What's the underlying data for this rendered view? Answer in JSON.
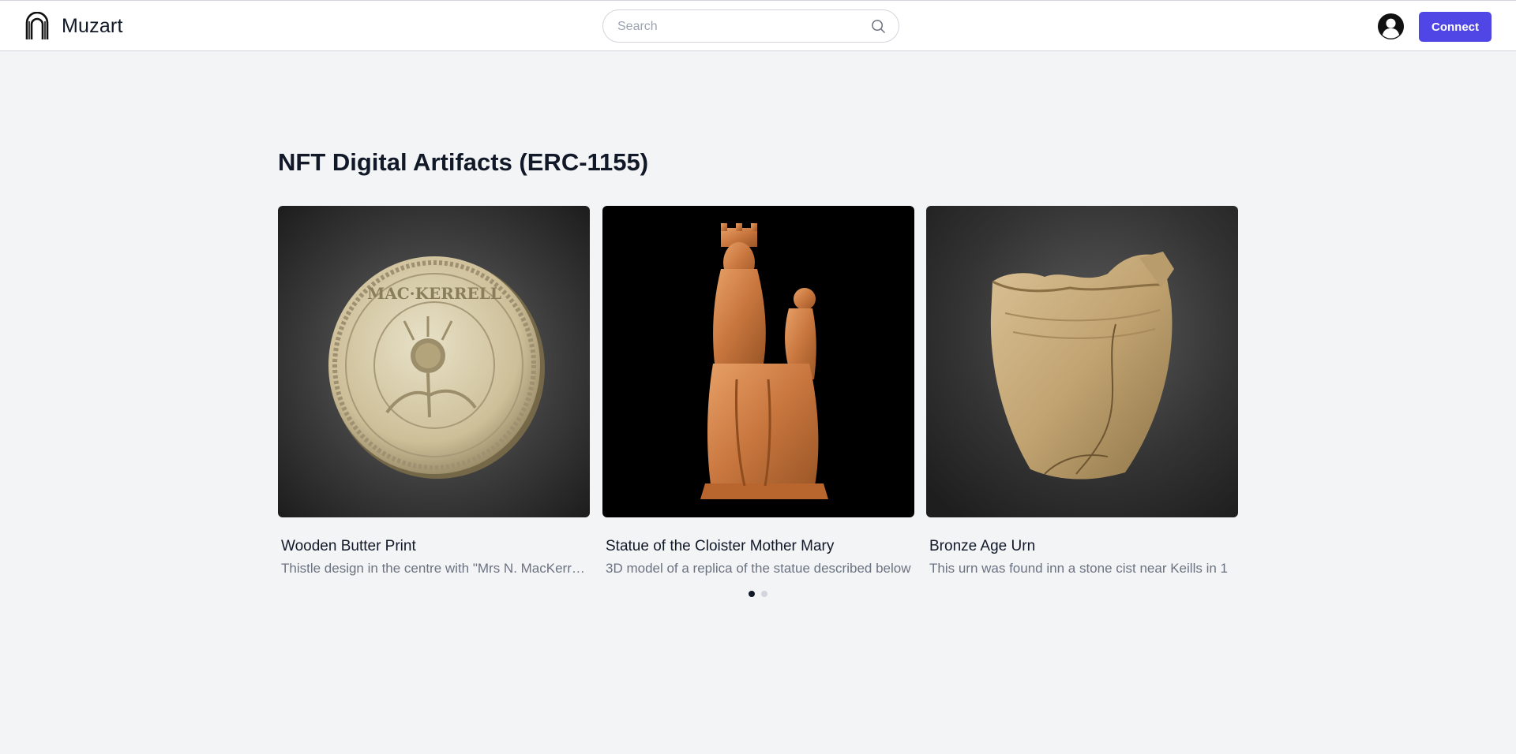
{
  "header": {
    "brand_name": "Muzart",
    "logo_icon": "arch-logo-icon",
    "search_placeholder": "Search",
    "search_icon": "search-icon",
    "user_icon": "user-circle-icon",
    "connect_label": "Connect",
    "accent_color": "#4f46e5"
  },
  "main": {
    "section_title": "NFT Digital Artifacts (ERC-1155)",
    "cards": [
      {
        "name": "Wooden Butter Print",
        "description": "Thistle design in the centre with \"Mrs N. MacKerrell\" around the edge",
        "image": "wooden-butter-print-image"
      },
      {
        "name": "Statue of the Cloister Mother Mary",
        "description": "3D model of a replica of the statue described below",
        "image": "mother-mary-statue-image"
      },
      {
        "name": "Bronze Age Urn",
        "description": "This urn was found inn a stone cist near Keills in 1",
        "image": "bronze-age-urn-image"
      }
    ],
    "carousel": {
      "page_count": 2,
      "active_page": 1
    }
  }
}
